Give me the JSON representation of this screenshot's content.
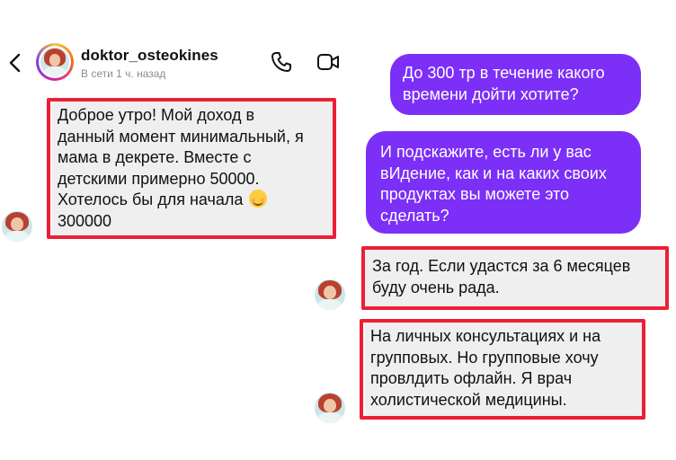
{
  "header": {
    "username": "doktor_osteokines",
    "status": "В сети 1 ч. назад",
    "back_icon": "chevron-left-icon",
    "call_icon": "phone-icon",
    "video_icon": "video-camera-icon"
  },
  "messages": [
    {
      "side": "incoming",
      "text_before_emoji": "Доброе утро! Мой доход в\nданный момент минимальный, я\nмама в декрете. Вместе с\nдетскими примерно 50000.\nХотелось бы для начала ",
      "emoji": "smiling-face-emoji",
      "text_after_emoji": "\n300000",
      "highlighted": true
    },
    {
      "side": "outgoing",
      "text": "До 300 тр в течение какого\nвремени дойти хотите?"
    },
    {
      "side": "outgoing",
      "text": "И подскажите, есть ли у вас\nвИдение, как и на каких своих\nпродуктах вы можете это\nсделать?"
    },
    {
      "side": "incoming",
      "text": "За год. Если удастся за 6 месяцев\nбуду очень рада.",
      "highlighted": true
    },
    {
      "side": "incoming",
      "text": "На личных консультациях и на\nгрупповых. Но групповые хочу\nпровлдить офлайн. Я врач\nхолистической медицины.",
      "highlighted": true
    }
  ],
  "colors": {
    "outgoing_bubble": "#7b2ff7",
    "incoming_bubble": "#efefef",
    "highlight_border": "#ec1f35"
  }
}
